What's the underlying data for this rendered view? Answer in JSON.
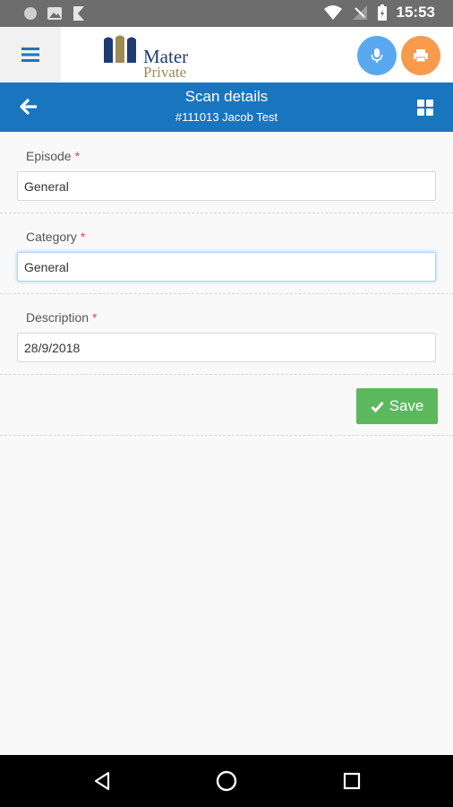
{
  "status_bar": {
    "time": "15:53"
  },
  "app_bar": {
    "logo": {
      "line1": "Mater",
      "line2": "Private"
    }
  },
  "header": {
    "title": "Scan details",
    "subtitle": "#111013 Jacob Test"
  },
  "form": {
    "episode": {
      "label": "Episode",
      "required_mark": "*",
      "value": "General"
    },
    "category": {
      "label": "Category",
      "required_mark": "*",
      "value": "General"
    },
    "description": {
      "label": "Description",
      "required_mark": "*",
      "value": "28/9/2018"
    }
  },
  "actions": {
    "save_label": "Save"
  },
  "colors": {
    "header_blue": "#1a75bf",
    "mic_button": "#5aa9f0",
    "print_button": "#f89a4c",
    "save_green": "#5cb85c",
    "required_red": "#e04848"
  },
  "icons": {
    "menu": "hamburger-icon",
    "mic": "microphone-icon",
    "print": "printer-icon",
    "back": "arrow-left-icon",
    "grid": "grid-icon",
    "save": "check-icon"
  }
}
